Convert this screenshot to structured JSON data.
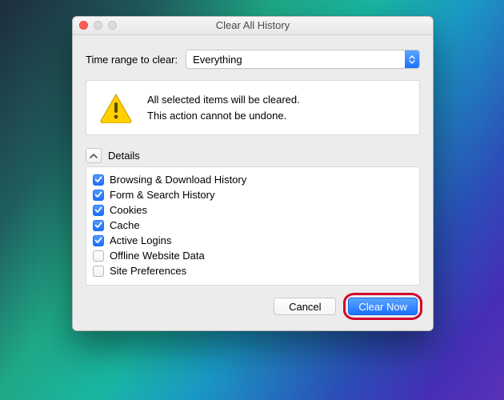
{
  "window": {
    "title": "Clear All History"
  },
  "range": {
    "label": "Time range to clear:",
    "selected": "Everything"
  },
  "warning": {
    "line1": "All selected items will be cleared.",
    "line2": "This action cannot be undone."
  },
  "details": {
    "header": "Details",
    "items": [
      {
        "label": "Browsing & Download History",
        "checked": true
      },
      {
        "label": "Form & Search History",
        "checked": true
      },
      {
        "label": "Cookies",
        "checked": true
      },
      {
        "label": "Cache",
        "checked": true
      },
      {
        "label": "Active Logins",
        "checked": true
      },
      {
        "label": "Offline Website Data",
        "checked": false
      },
      {
        "label": "Site Preferences",
        "checked": false
      }
    ]
  },
  "buttons": {
    "cancel": "Cancel",
    "clear_now": "Clear Now"
  }
}
